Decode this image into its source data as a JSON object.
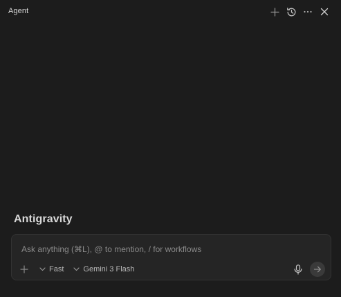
{
  "header": {
    "title": "Agent",
    "actions": [
      {
        "icon": "plus-icon"
      },
      {
        "icon": "history-icon"
      },
      {
        "icon": "more-icon"
      },
      {
        "icon": "close-icon"
      }
    ]
  },
  "main": {
    "brand": "Antigravity"
  },
  "composer": {
    "placeholder": "Ask anything (⌘L), @ to mention, / for workflows",
    "value": "",
    "mode_label": "Fast",
    "model_label": "Gemini 3 Flash"
  },
  "colors": {
    "background": "#1c1c1c",
    "composer_bg": "#252525",
    "composer_border": "#333333",
    "send_button_bg": "#3a3a3a",
    "text_primary": "#d8d8d8",
    "text_placeholder": "#8a8a8a"
  }
}
